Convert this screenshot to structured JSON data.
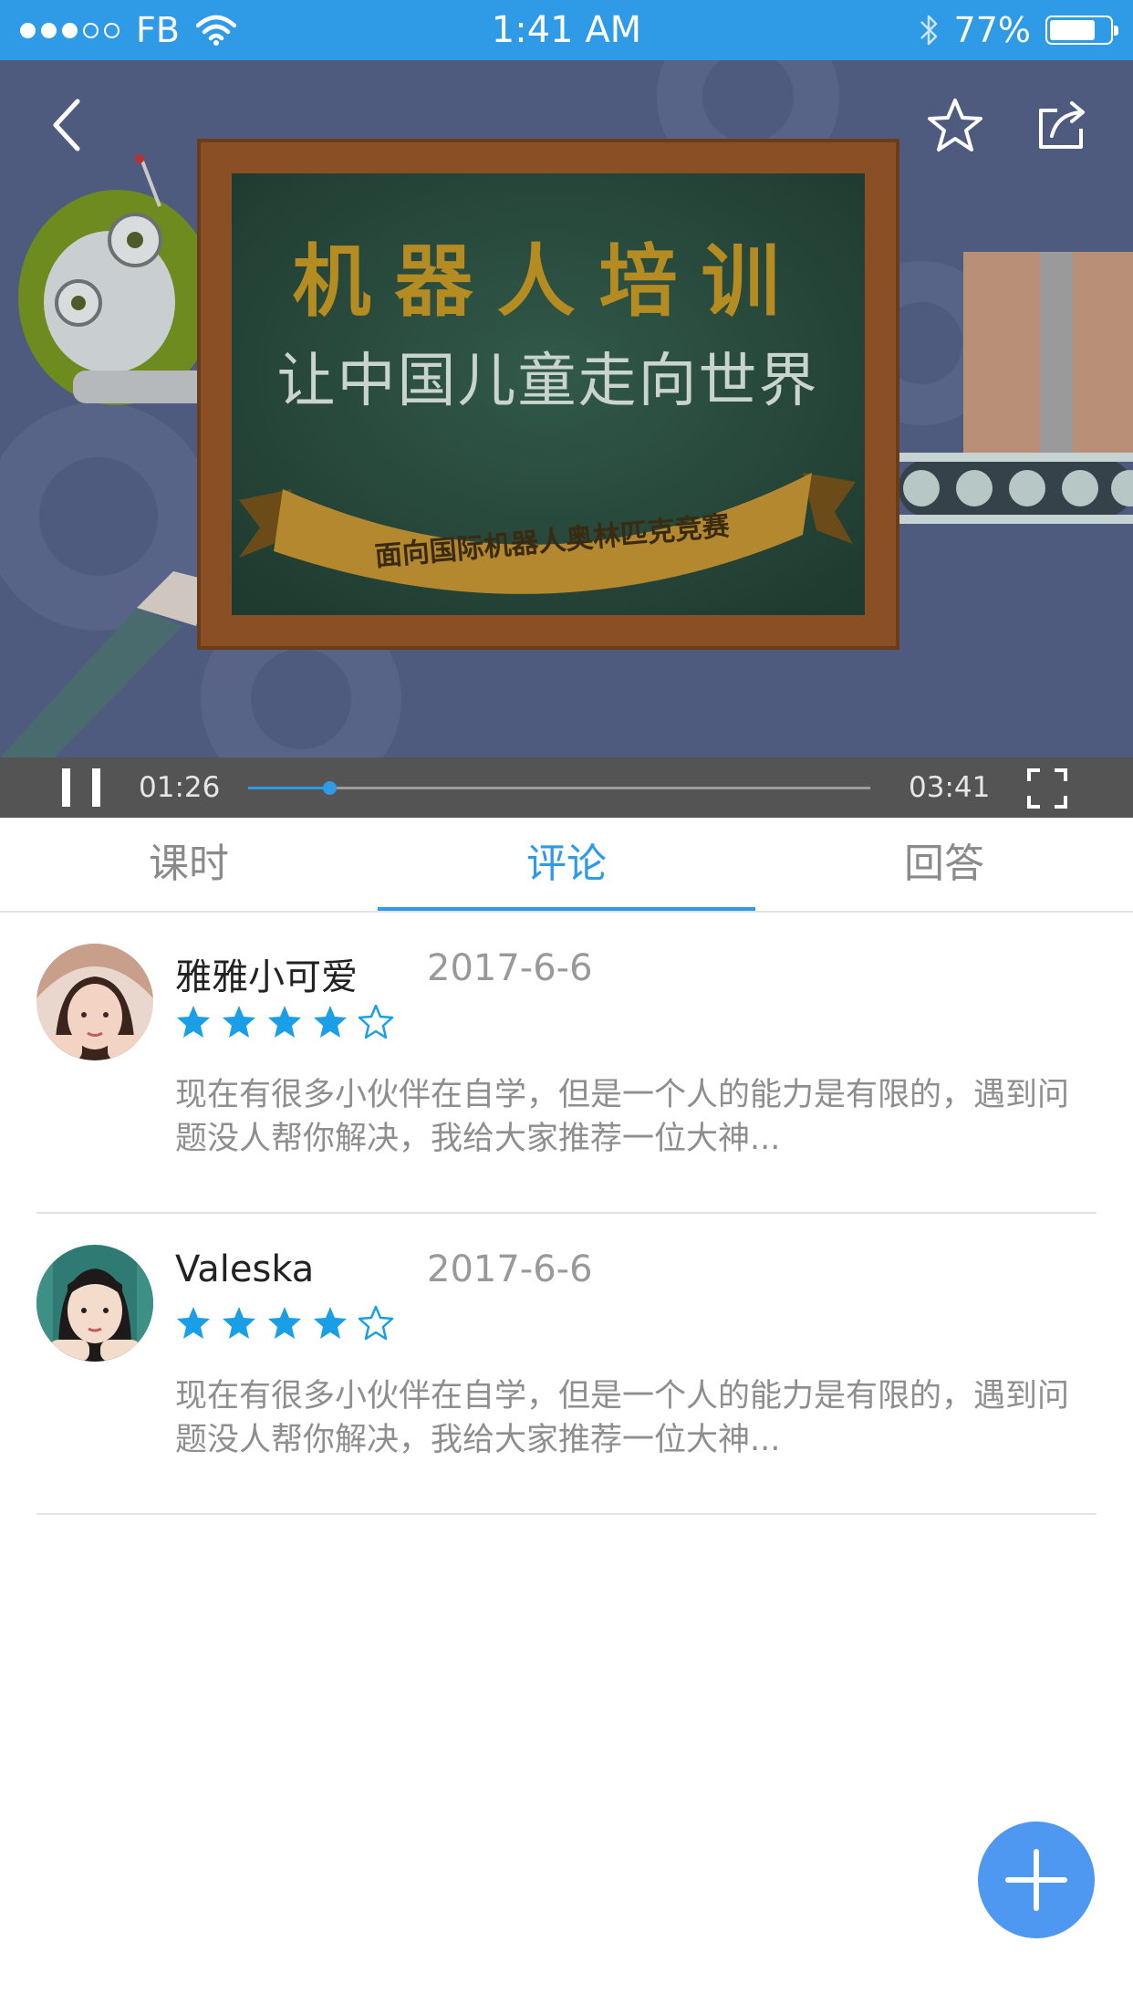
{
  "status_bar": {
    "carrier": "FB",
    "time": "1:41 AM",
    "battery_percent_text": "77%",
    "battery_level": 0.77,
    "signal_bars_filled": 3,
    "signal_bars_total": 5
  },
  "video": {
    "board_title": "机器人培训",
    "board_subtitle": "让中国儿童走向世界",
    "ribbon_text": "面向国际机器人奥林匹克竞赛",
    "icons": {
      "back": "back-arrow-icon",
      "favorite": "star-outline-icon",
      "share": "share-icon"
    }
  },
  "player": {
    "current_time": "01:26",
    "duration": "03:41",
    "progress": 0.13,
    "icons": {
      "pause": "pause-icon",
      "fullscreen": "fullscreen-icon"
    }
  },
  "tabs": [
    {
      "label": "课时"
    },
    {
      "label": "评论"
    },
    {
      "label": "回答"
    }
  ],
  "active_tab": 1,
  "comments": [
    {
      "name": "雅雅小可爱",
      "date": "2017-6-6",
      "rating": 4,
      "rating_max": 5,
      "text": "现在有很多小伙伴在自学，但是一个人的能力是有限的，遇到问题没人帮你解决，我给大家推荐一位大神..."
    },
    {
      "name": "Valeska",
      "date": "2017-6-6",
      "rating": 4,
      "rating_max": 5,
      "text": "现在有很多小伙伴在自学，但是一个人的能力是有限的，遇到问题没人帮你解决，我给大家推荐一位大神..."
    }
  ],
  "fab": {
    "icon": "plus-icon"
  },
  "colors": {
    "accent": "#2f9ae6",
    "star": "#1a9ee6",
    "fab": "#4f98f2",
    "control_bar": "#545454"
  }
}
